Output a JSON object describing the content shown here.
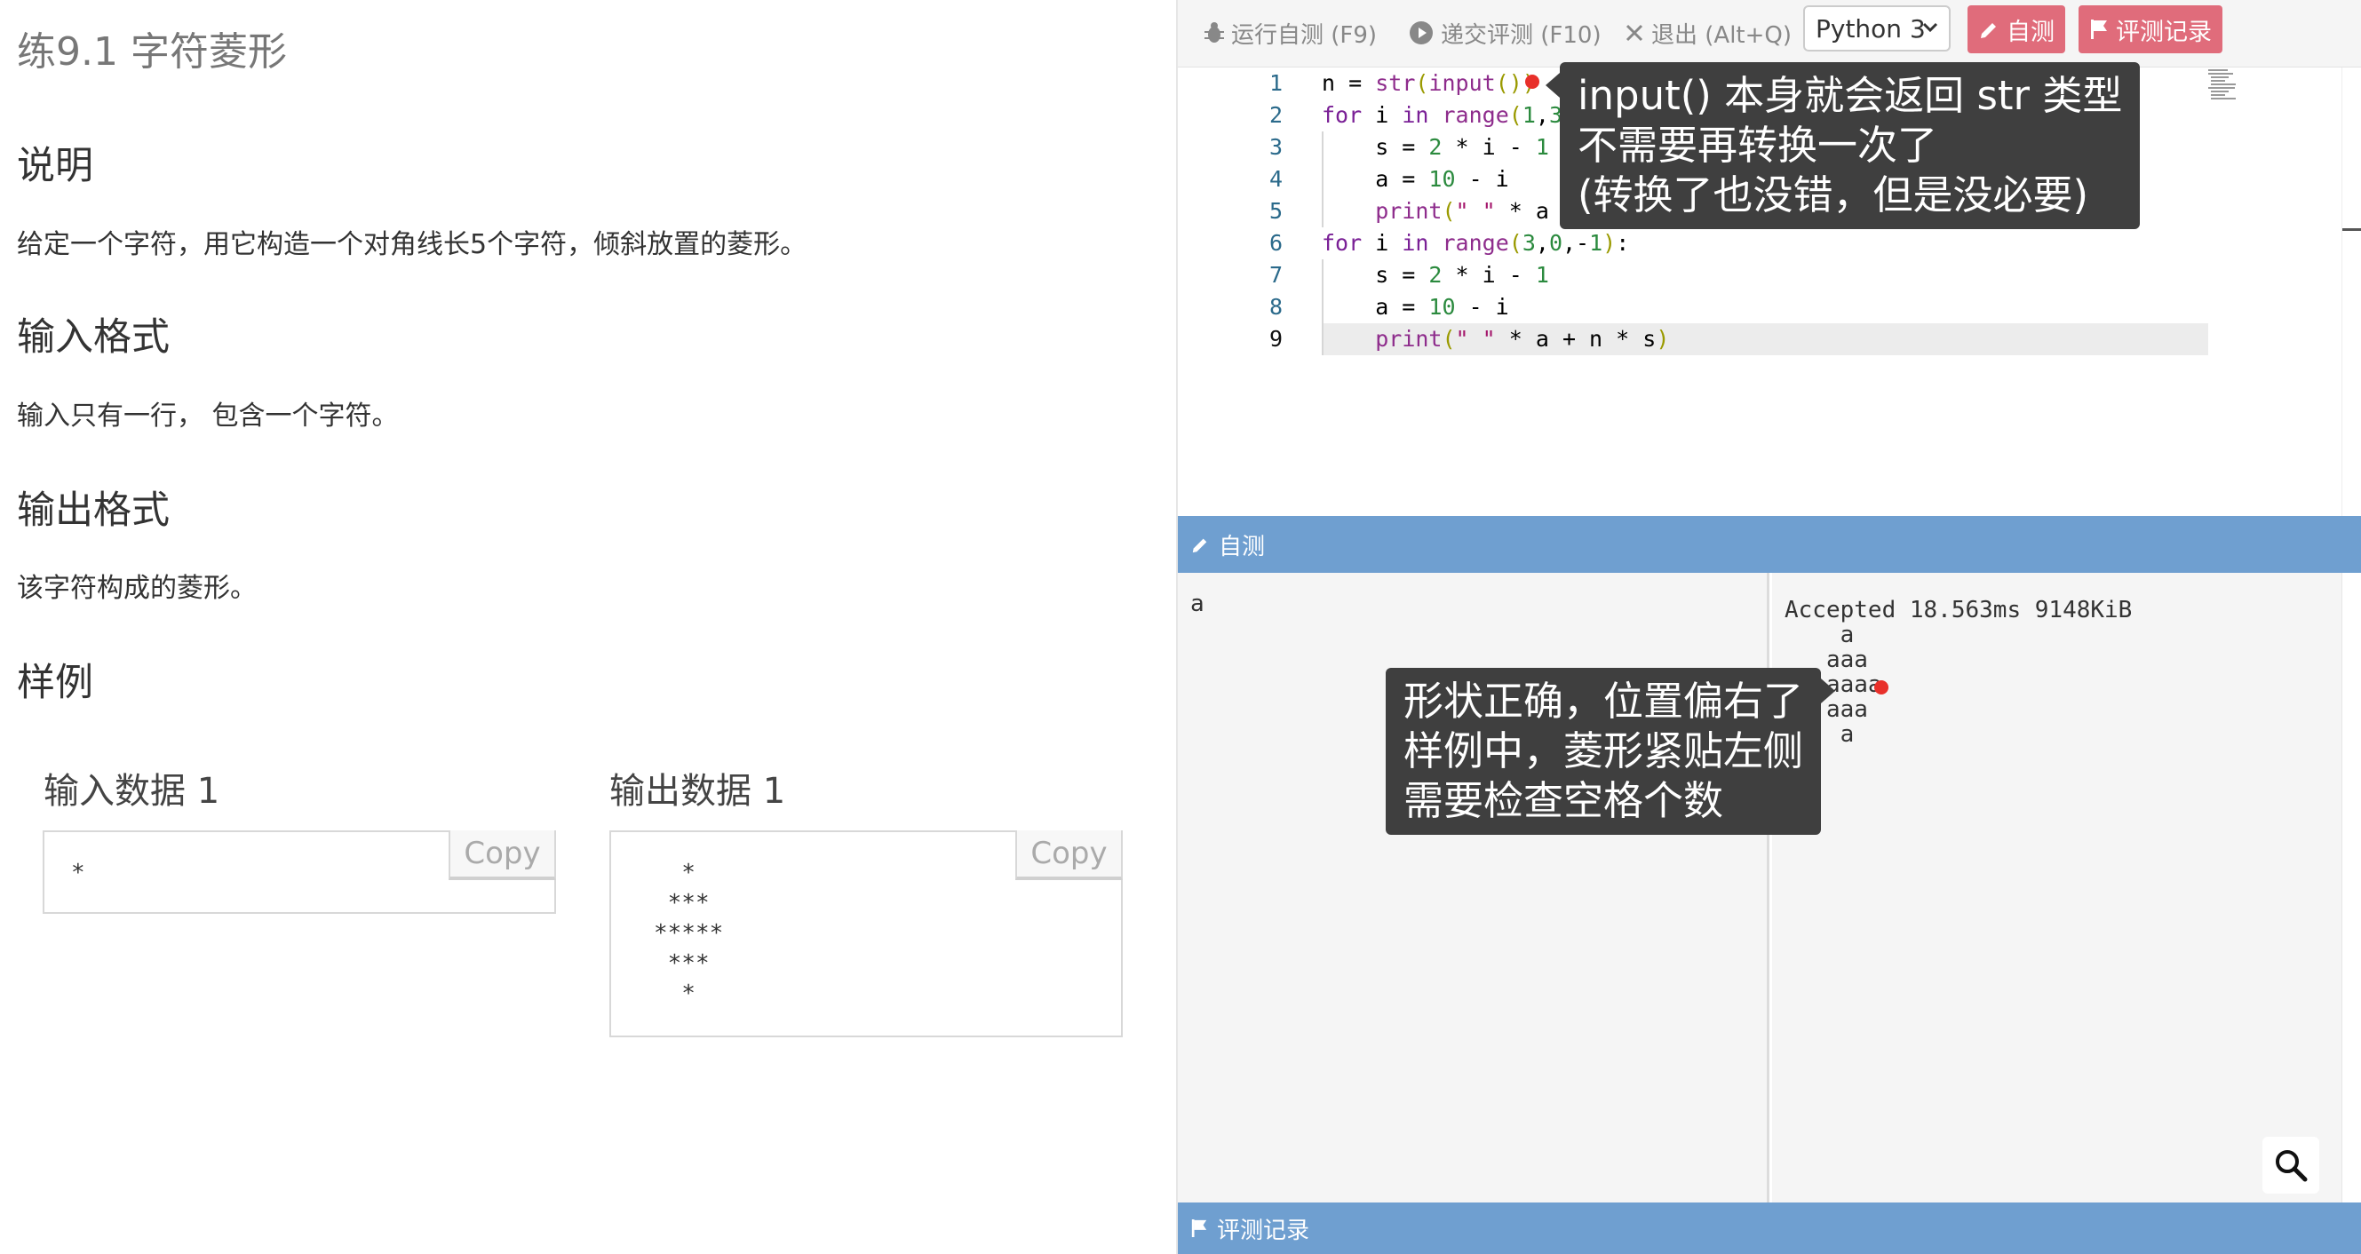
{
  "problem": {
    "title": "练9.1 字符菱形",
    "description_heading": "说明",
    "description_text": "给定一个字符，用它构造一个对角线长5个字符，倾斜放置的菱形。",
    "input_heading": "输入格式",
    "input_text": "输入只有一行， 包含一个字符。",
    "output_heading": "输出格式",
    "output_text": "该字符构成的菱形。",
    "sample_heading": "样例",
    "sample_input_heading": "输入数据 1",
    "sample_input": "*",
    "sample_output_heading": "输出数据 1",
    "sample_output": "  *\n ***\n*****\n ***\n  *",
    "copy_label": "Copy"
  },
  "toolbar": {
    "run_label": "运行自测 (F9)",
    "submit_label": "递交评测 (F10)",
    "exit_label": "退出 (Alt+Q)",
    "language": "Python 3",
    "selftest_button": "自测",
    "records_button": "评测记录",
    "accent_color": "#e06c7b"
  },
  "editor": {
    "line_numbers": [
      "1",
      "2",
      "3",
      "4",
      "5",
      "6",
      "7",
      "8",
      "9"
    ],
    "active_line": 9,
    "lines": [
      "n = str(input())",
      "for i in range(1,3):",
      "    s = 2 * i - 1",
      "    a = 10 - i",
      "    print(\" \" * a + n * s)",
      "for i in range(3,0,-1):",
      "    s = 2 * i - 1",
      "    a = 10 - i",
      "    print(\" \" * a + n * s)"
    ]
  },
  "selftest": {
    "panel_title": "自测",
    "input_value": "a",
    "output_status": "Accepted 18.563ms 9148KiB",
    "output_text": "    a\n   aaa\n  aaaaa\n   aaa\n    a",
    "panel_color": "#6f9fd0"
  },
  "records": {
    "panel_title": "评测记录"
  },
  "annotations": {
    "callout_input": [
      "input() 本身就会返回 str 类型",
      "不需要再转换一次了",
      "(转换了也没错，但是没必要)"
    ],
    "callout_output": [
      "形状正确，位置偏右了",
      "样例中，菱形紧贴左侧",
      "需要检查空格个数"
    ]
  }
}
